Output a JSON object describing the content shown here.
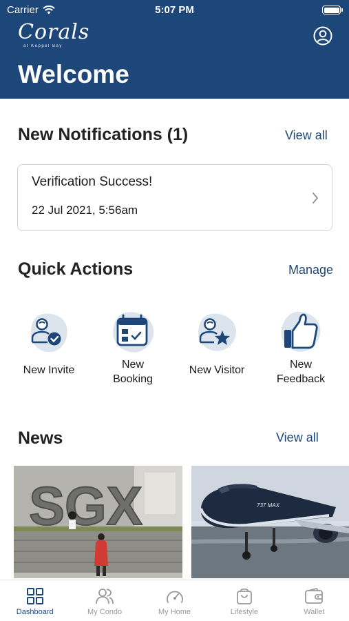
{
  "status_bar": {
    "carrier": "Carrier",
    "time": "5:07 PM"
  },
  "header": {
    "logo_main": "Corals",
    "logo_sub": "at Keppel Bay",
    "welcome": "Welcome"
  },
  "notifications": {
    "title": "New Notifications (1)",
    "view_all": "View all",
    "items": [
      {
        "title": "Verification Success!",
        "time": "22 Jul 2021, 5:56am"
      }
    ]
  },
  "quick_actions": {
    "title": "Quick Actions",
    "manage": "Manage",
    "items": [
      {
        "label": "New Invite",
        "icon": "person-check-icon"
      },
      {
        "label": "New\nBooking",
        "icon": "calendar-check-icon"
      },
      {
        "label": "New Visitor",
        "icon": "person-star-icon"
      },
      {
        "label": "New\nFeedback",
        "icon": "thumbs-up-icon"
      }
    ]
  },
  "news": {
    "title": "News",
    "view_all": "View all"
  },
  "tabbar": {
    "items": [
      {
        "label": "Dashboard",
        "icon": "grid-icon",
        "active": true
      },
      {
        "label": "My Condo",
        "icon": "people-icon",
        "active": false
      },
      {
        "label": "My Home",
        "icon": "gauge-icon",
        "active": false
      },
      {
        "label": "Lifestyle",
        "icon": "bag-icon",
        "active": false
      },
      {
        "label": "Wallet",
        "icon": "wallet-icon",
        "active": false
      }
    ]
  },
  "colors": {
    "brand": "#1d4778",
    "icon_blob": "#dce4ee",
    "inactive": "#9a9a9a"
  }
}
